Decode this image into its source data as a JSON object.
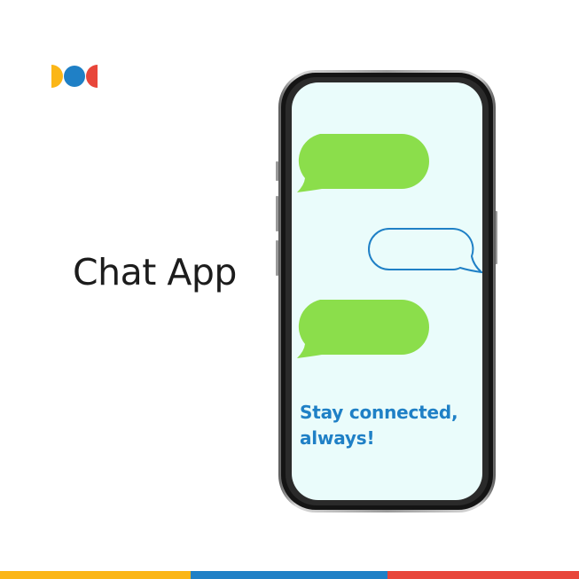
{
  "brand": {
    "logo_icon": "brand-logo-icon",
    "colors": {
      "yellow": "#fbb617",
      "blue": "#1f80c6",
      "red": "#e8463a"
    }
  },
  "headline": "Chat App",
  "phone": {
    "tagline": "Stay connected, always!",
    "bubbles": [
      {
        "role": "received",
        "style": "filled",
        "color": "#8bde4b"
      },
      {
        "role": "sent",
        "style": "outline",
        "color": "#1f80c6"
      },
      {
        "role": "received",
        "style": "filled",
        "color": "#8bde4b"
      }
    ],
    "screen_color": "#eafcfb"
  },
  "bottom_bar": {
    "colors": [
      "#fbb617",
      "#1f80c6",
      "#e8463a"
    ]
  }
}
